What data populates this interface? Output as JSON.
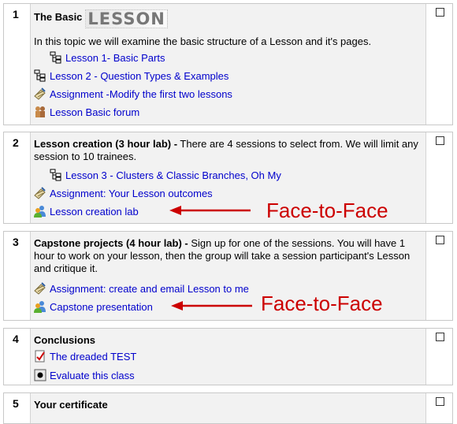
{
  "sections": [
    {
      "number": "1",
      "title": "The Basic",
      "title_image_text": "LESSON",
      "summary": "In this topic we will examine the basic structure of a Lesson and it's pages.",
      "activities": [
        {
          "label": "Lesson 1- Basic Parts",
          "icon": "lesson-icon"
        },
        {
          "label": "Lesson 2 - Question Types & Examples",
          "icon": "lesson-icon"
        },
        {
          "label": "Assignment -Modify the first two lessons",
          "icon": "assignment-icon"
        },
        {
          "label": "Lesson Basic forum",
          "icon": "forum-icon"
        }
      ]
    },
    {
      "number": "2",
      "title": "Lesson creation (3 hour lab) -",
      "summary": " There are 4 sessions to select from. We will limit any session to 10 trainees.",
      "activities": [
        {
          "label": "Lesson 3 - Clusters & Classic Branches, Oh My",
          "icon": "lesson-icon"
        },
        {
          "label": "Assignment: Your Lesson outcomes",
          "icon": "assignment-icon"
        },
        {
          "label": "Lesson creation lab",
          "icon": "face-to-face-icon"
        }
      ],
      "annotation": "Face-to-Face"
    },
    {
      "number": "3",
      "title": "Capstone projects (4 hour lab) -",
      "summary": " Sign up for one of the sessions. You will have 1 hour to work on your lesson, then the group will take a session participant's Lesson and critique it.",
      "activities": [
        {
          "label": "Assignment: create and email Lesson to me",
          "icon": "assignment-icon"
        },
        {
          "label": "Capstone presentation",
          "icon": "face-to-face-icon"
        }
      ],
      "annotation": "Face-to-Face"
    },
    {
      "number": "4",
      "title": "Conclusions",
      "activities": [
        {
          "label": "The dreaded TEST",
          "icon": "quiz-icon"
        },
        {
          "label": "Evaluate this class",
          "icon": "feedback-icon"
        }
      ]
    },
    {
      "number": "5",
      "title": "Your certificate"
    }
  ],
  "colors": {
    "link": "#0000cc",
    "annotation": "#cc0000",
    "section_bg": "#f2f2f2",
    "border": "#c8c8c8"
  }
}
